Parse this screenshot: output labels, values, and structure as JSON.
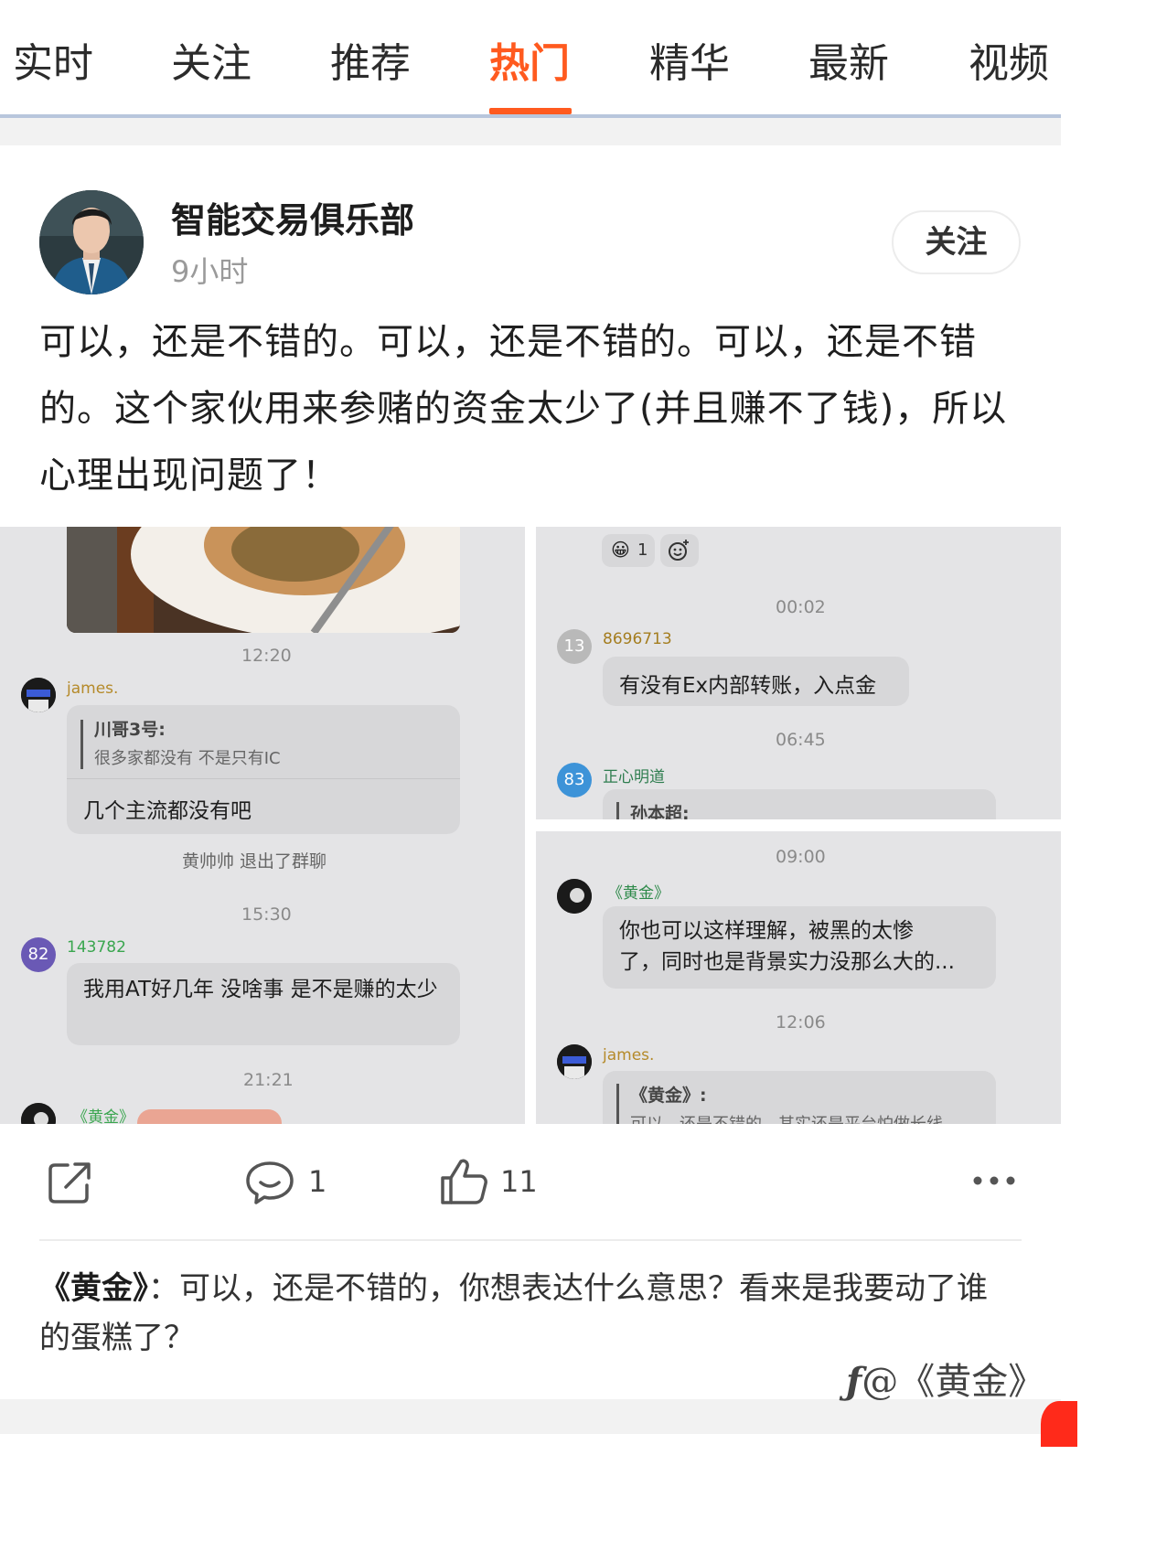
{
  "tabs": [
    {
      "label": "实时"
    },
    {
      "label": "关注"
    },
    {
      "label": "推荐"
    },
    {
      "label": "热门",
      "active": true
    },
    {
      "label": "精华"
    },
    {
      "label": "最新"
    },
    {
      "label": "视频"
    }
  ],
  "post": {
    "author": "智能交易俱乐部",
    "time": "9小时",
    "follow_label": "关注",
    "text": "可以，还是不错的。可以，还是不错的。可以，还是不错的。这个家伙用来参赌的资金太少了(并且赚不了钱)，所以心理出现问题了！"
  },
  "screenshot_left": {
    "ts1": "12:20",
    "msg1_sender": "james.",
    "msg1_quote_name": "川哥3号:",
    "msg1_quote_text": "很多家都没有 不是只有IC",
    "msg1_text": "几个主流都没有吧",
    "system_notice": "黄帅帅  退出了群聊",
    "ts2": "15:30",
    "msg2_avatar": "82",
    "msg2_sender": "143782",
    "msg2_text": "我用AT好几年 没啥事 是不是赚的太少",
    "ts3": "21:21",
    "msg3_sender": "《黄金》"
  },
  "screenshot_right_a": {
    "reaction_count": "1",
    "ts1": "00:02",
    "msg1_avatar": "13",
    "msg1_sender": "8696713",
    "msg1_text": "有没有Ex内部转账，入点金",
    "ts2": "06:45",
    "msg2_avatar": "83",
    "msg2_sender": "正心明道",
    "msg2_quote_name": "孙本超:"
  },
  "screenshot_right_b": {
    "ts1": "09:00",
    "msg1_sender": "《黄金》",
    "msg1_text_line1": "你也可以这样理解，被黑的太惨",
    "msg1_text_line2": "了，同时也是背景实力没那么大的...",
    "ts2": "12:06",
    "msg2_sender": "james.",
    "msg2_quote_name": "《黄金》:",
    "msg2_quote_text": "可以，还是不错的，其实还是平台怕做长线"
  },
  "actions": {
    "comment_count": "1",
    "like_count": "11"
  },
  "top_comment": {
    "author": "《黄金》",
    "text": "：可以，还是不错的，你想表达什么意思？看来是我要动了谁的蛋糕了？"
  },
  "watermark": "@《黄金》",
  "colors": {
    "accent": "#ff5a1f",
    "tab_underline_rule": "#b8c6dc"
  }
}
